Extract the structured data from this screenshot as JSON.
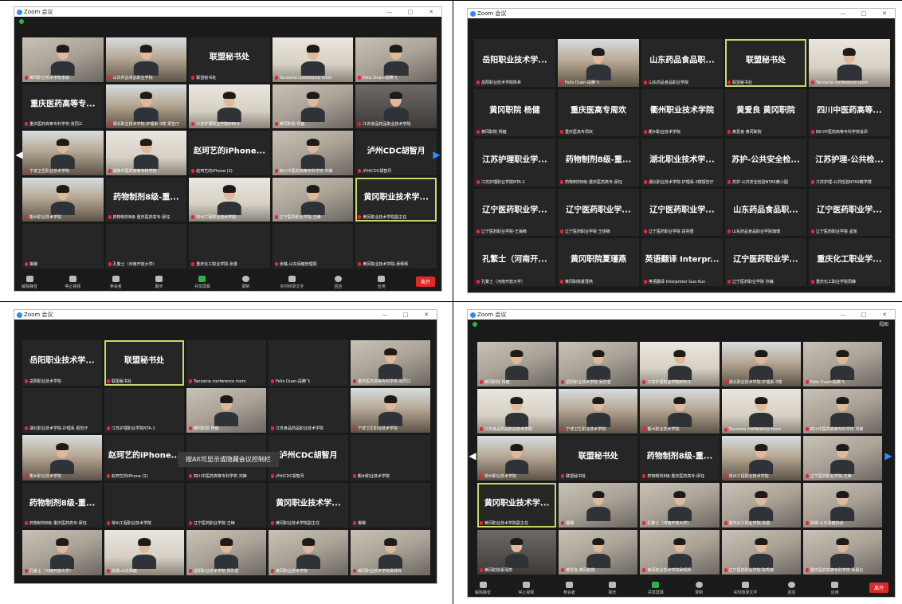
{
  "panels": {
    "tl": {
      "title": "Zoom 会议",
      "ctrls": [
        "—",
        "□",
        "✕"
      ],
      "view": "",
      "tiles": [
        {
          "k": "video",
          "name": "黄冈职业技术学院李娟"
        },
        {
          "k": "video room",
          "name": "山东药品食品职业学院"
        },
        {
          "k": "text",
          "big": "联盟秘书处",
          "name": "联盟秘书处"
        },
        {
          "k": "video office",
          "name": "Tanzania conference room"
        },
        {
          "k": "video",
          "name": "Felix Duan-段腾飞"
        },
        {
          "k": "text",
          "big": "重庆医药高等专...",
          "name": "重庆医药高等专科学校-张同江"
        },
        {
          "k": "video room",
          "name": "湖北职业技术学院-护理系-3楼 报告厅"
        },
        {
          "k": "video office",
          "name": "江苏护理职业学院NTA-1"
        },
        {
          "k": "video",
          "name": "黄冈职院 杨健"
        },
        {
          "k": "video dark",
          "name": "江苏食品药品职业技术学院"
        },
        {
          "k": "video room",
          "name": "宁波卫生职业技术学院"
        },
        {
          "k": "video office",
          "name": "湖南中医药高等专科学校"
        },
        {
          "k": "text",
          "big": "赵珂艺的iPhone...",
          "name": "赵珂艺的iPhone (2)"
        },
        {
          "k": "video",
          "name": "四川中医药高等专科学校 刘婵"
        },
        {
          "k": "text",
          "big": "泸州CDC胡智月",
          "name": "泸州CDC胡智月"
        },
        {
          "k": "video room",
          "name": "衢州职业技术学院"
        },
        {
          "k": "text",
          "big": "药物制剂8级-重...",
          "name": "药物制剂8级-重庆医药高专-廖钰"
        },
        {
          "k": "video office",
          "name": "常州工程职业技术学院"
        },
        {
          "k": "video",
          "name": "辽宁医药职业学院-王峥"
        },
        {
          "k": "text active",
          "big": "黄冈职业技术学...",
          "name": "黄冈职业技术学院副主任"
        },
        {
          "k": "text",
          "big": "",
          "name": "楊楊"
        },
        {
          "k": "text",
          "big": "",
          "name": "孔繁士（河南开放大学）"
        },
        {
          "k": "text",
          "big": "",
          "name": "重庆化工职业学院-张勇"
        },
        {
          "k": "text",
          "big": "",
          "name": "张璐-山东保健管理局"
        },
        {
          "k": "text",
          "big": "",
          "name": "黄冈职业技术学院-吴辉辉"
        }
      ],
      "toolbar": [
        "解除静音",
        "停止视频",
        "参会者",
        "聊天",
        "共享屏幕",
        "录制",
        "实时转录文字",
        "回应",
        "应用"
      ],
      "participants": "65",
      "leave": "离开"
    },
    "tr": {
      "title": "Zoom 会议",
      "ctrls": [
        "—",
        "□",
        "✕"
      ],
      "view": "",
      "tiles": [
        {
          "k": "text",
          "big": "岳阳职业技术学...",
          "name": "岳阳职业技术学院陈希"
        },
        {
          "k": "video room",
          "name": "Felix Duan-段腾飞"
        },
        {
          "k": "text",
          "big": "山东药品食品职...",
          "name": "山东药品食品职业学院"
        },
        {
          "k": "text active",
          "big": "联盟秘书处",
          "name": "联盟秘书处"
        },
        {
          "k": "video office",
          "name": "Tanzania conference room"
        },
        {
          "k": "text",
          "big": "黄冈职院 杨健",
          "name": "黄冈职院 杨健"
        },
        {
          "k": "text",
          "big": "重庆医高专周欢",
          "name": "重庆医高专周欢"
        },
        {
          "k": "text",
          "big": "衢州职业技术学院",
          "name": "衢州职业技术学院"
        },
        {
          "k": "text",
          "big": "黄爱良 黄冈职院",
          "name": "黄爱良 黄冈职院"
        },
        {
          "k": "text",
          "big": "四川中医药高等...",
          "name": "四川中医药高等专科学校肖昂"
        },
        {
          "k": "text",
          "big": "江苏护理职业学...",
          "name": "江苏护理职业学院NTA-1"
        },
        {
          "k": "text",
          "big": "药物制剂8级-重...",
          "name": "药物制剂8级-重庆医药高专-廖钰"
        },
        {
          "k": "text",
          "big": "湖北职业技术学...",
          "name": "湖北职业技术学院-护理系-3楼报告厅"
        },
        {
          "k": "text",
          "big": "苏护-公共安全检...",
          "name": "苏护-公共安全检验NTA5教小圆"
        },
        {
          "k": "text",
          "big": "江苏护理-公共检...",
          "name": "江苏护理-公共检验NTA9教学楼"
        },
        {
          "k": "text",
          "big": "辽宁医药职业学...",
          "name": "辽宁医药职业学院-王海楠"
        },
        {
          "k": "text",
          "big": "辽宁医药职业学...",
          "name": "辽宁医药职业学院 王铁楠"
        },
        {
          "k": "text",
          "big": "辽宁医药职业学...",
          "name": "辽宁医药职业学院 段亮晋"
        },
        {
          "k": "text",
          "big": "山东药品食品职...",
          "name": "山东药品食品职业学院瀚博"
        },
        {
          "k": "text",
          "big": "辽宁医药职业学...",
          "name": "辽宁医药职业学院 孟瑶"
        },
        {
          "k": "text",
          "big": "孔繁士（河南开...",
          "name": "孔繁士（河南开放大学）"
        },
        {
          "k": "text",
          "big": "黄冈职院夏瑾燕",
          "name": "黄冈职院夏瑾燕"
        },
        {
          "k": "text",
          "big": "英语翻译 Interpr...",
          "name": "英语翻译 Interpreter Guo Kun"
        },
        {
          "k": "text",
          "big": "辽宁医药职业学...",
          "name": "辽宁医药职业学院 孙巍"
        },
        {
          "k": "text",
          "big": "重庆化工职业学...",
          "name": "重庆化工职业学院周静"
        }
      ]
    },
    "bl": {
      "title": "Zoom 会议",
      "ctrls": [
        "—",
        "□",
        "✕"
      ],
      "view": "",
      "tiles": [
        {
          "k": "text",
          "big": "岳阳职业技术学...",
          "name": "岳阳职业技术学院"
        },
        {
          "k": "text active",
          "big": "联盟秘书处",
          "name": "联盟秘书处"
        },
        {
          "k": "text",
          "big": "",
          "name": "Tanzania conference room"
        },
        {
          "k": "text",
          "big": "",
          "name": "Felix Duan-段腾飞"
        },
        {
          "k": "video",
          "name": "重庆医药高等专科学校-张同江"
        },
        {
          "k": "text",
          "big": "",
          "name": "湖北职业技术学院-护理系 报告厅"
        },
        {
          "k": "text",
          "big": "",
          "name": "江苏护理职业学院NTA-1"
        },
        {
          "k": "video",
          "name": "黄冈职院 杨健"
        },
        {
          "k": "text",
          "big": "",
          "name": "江苏食品药品职业技术学院"
        },
        {
          "k": "video room",
          "name": "宁波卫生职业技术学院"
        },
        {
          "k": "video room",
          "name": "衢州职业技术学院"
        },
        {
          "k": "text",
          "big": "赵珂艺的iPhone...",
          "name": "赵珂艺的iPhone (2)"
        },
        {
          "k": "text",
          "big": "",
          "name": "四川中医药高等专科学校 刘婵"
        },
        {
          "k": "text",
          "big": "泸州CDC胡智月",
          "name": "泸州CDC胡智月"
        },
        {
          "k": "text",
          "big": "",
          "name": "衢州职业技术学院"
        },
        {
          "k": "text",
          "big": "药物制剂8级-重...",
          "name": "药物制剂8级-重庆医药高专-廖钰"
        },
        {
          "k": "text",
          "big": "",
          "name": "常州工程职业技术学院"
        },
        {
          "k": "text",
          "big": "",
          "name": "辽宁医药职业学院-王峥"
        },
        {
          "k": "text",
          "big": "黄冈职业技术学...",
          "name": "黄冈职业技术学院副主任"
        },
        {
          "k": "text",
          "big": "",
          "name": "楊楊"
        },
        {
          "k": "video",
          "name": "孔繁士（河南开放大学）"
        },
        {
          "k": "video office",
          "name": "张璐-山东保健"
        },
        {
          "k": "video",
          "name": "岳阳职业技术学院 吴烈君"
        },
        {
          "k": "video",
          "name": "黄冈职业技术学院"
        },
        {
          "k": "video",
          "name": "黄冈职业技术学院吴辉辉"
        }
      ],
      "tooltip": "按Alt可显示或隐藏会议控制栏"
    },
    "br": {
      "title": "Zoom 会议",
      "ctrls": [
        "—",
        "□",
        "✕"
      ],
      "view": "视图",
      "tiles": [
        {
          "k": "video",
          "name": "黄冈职院 杨健"
        },
        {
          "k": "video",
          "name": "岳阳职业技术学院 吴烈君"
        },
        {
          "k": "video office",
          "name": "江苏护理职业学院NTA-1"
        },
        {
          "k": "video room",
          "name": "湖北职业技术学院-护理系-3楼"
        },
        {
          "k": "video",
          "name": "Felix Duan-段腾飞"
        },
        {
          "k": "video office",
          "name": "江苏食品药品职业技术学院"
        },
        {
          "k": "video room",
          "name": "宁波卫生职业技术学院"
        },
        {
          "k": "video room",
          "name": "衢州职业技术学院"
        },
        {
          "k": "video office",
          "name": "Tanzania conference room"
        },
        {
          "k": "video",
          "name": "四川中医药高等专科学校 刘婵"
        },
        {
          "k": "video room",
          "name": "常州职业技术学院"
        },
        {
          "k": "text",
          "big": "联盟秘书处",
          "name": "联盟秘书处"
        },
        {
          "k": "text",
          "big": "药物制剂8级-重...",
          "name": "药物制剂8级-重庆医药高专-廖钰"
        },
        {
          "k": "video room",
          "name": "常州工程职业技术学院"
        },
        {
          "k": "video",
          "name": "辽宁医药职业学院-王峥"
        },
        {
          "k": "text active",
          "big": "黄冈职业技术学...",
          "name": "黄冈职业技术学院副主任"
        },
        {
          "k": "video",
          "name": "楊楊"
        },
        {
          "k": "video",
          "name": "孔繁士（河南开放大学）"
        },
        {
          "k": "video",
          "name": "重庆化工职业学院-张勇"
        },
        {
          "k": "video",
          "name": "张璐-山东保健协会"
        },
        {
          "k": "video dark",
          "name": "黄冈职院夏瑾燕"
        },
        {
          "k": "video",
          "name": "黄爱良 黄冈职院"
        },
        {
          "k": "video",
          "name": "黄冈职业技术学院吴辉辉"
        },
        {
          "k": "video",
          "name": "辽宁医药职业学院 陈秀琳"
        },
        {
          "k": "video",
          "name": "重庆医药高等专科学校 杨晨云"
        }
      ],
      "toolbar": [
        "解除静音",
        "停止视频",
        "参会者",
        "聊天",
        "共享屏幕",
        "录制",
        "实时转录文字",
        "回应",
        "应用"
      ],
      "participants": "65",
      "leave": "离开"
    }
  }
}
